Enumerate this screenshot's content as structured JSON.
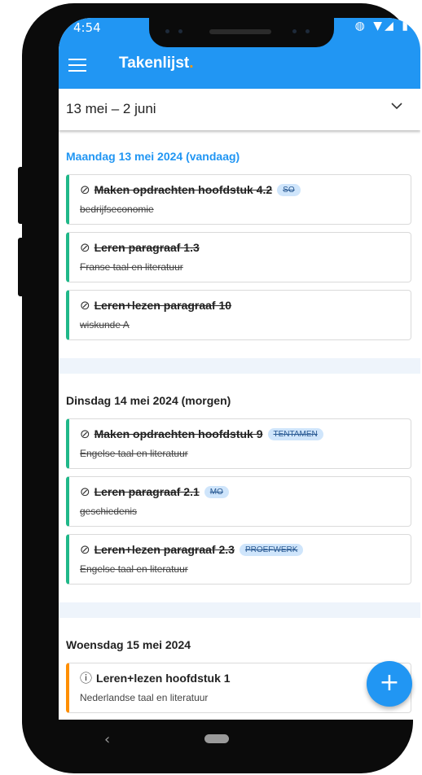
{
  "status": {
    "time": "4:54",
    "icons": "◍ ▼◢ ▮"
  },
  "appbar": {
    "title": "Takenlijst",
    "accent": "."
  },
  "range": {
    "label": "13 mei  –  2 juni"
  },
  "days": [
    {
      "header": "Maandag 13 mei 2024 (vandaag)",
      "tasks": [
        {
          "title": "Maken opdrachten hoofdstuk 4.2",
          "tag": "SO",
          "subject": "bedrijfseconomie",
          "status": "done"
        },
        {
          "title": "Leren paragraaf 1.3",
          "tag": "",
          "subject": "Franse taal en literatuur",
          "status": "done"
        },
        {
          "title": "Leren+lezen paragraaf 10",
          "tag": "",
          "subject": "wiskunde A",
          "status": "done"
        }
      ]
    },
    {
      "header": "Dinsdag 14 mei 2024 (morgen)",
      "tasks": [
        {
          "title": "Maken opdrachten hoofdstuk 9",
          "tag": "TENTAMEN",
          "subject": "Engelse taal en literatuur",
          "status": "done"
        },
        {
          "title": "Leren paragraaf 2.1",
          "tag": "MO",
          "subject": "geschiedenis",
          "status": "done"
        },
        {
          "title": "Leren+lezen paragraaf 2.3",
          "tag": "PROEFWERK",
          "subject": "Engelse taal en literatuur",
          "status": "done"
        }
      ]
    },
    {
      "header": "Woensdag 15 mei 2024",
      "tasks": [
        {
          "title": "Leren+lezen hoofdstuk 1",
          "tag": "",
          "subject": "Nederlandse taal en literatuur",
          "status": "pending"
        }
      ]
    }
  ],
  "icons": {
    "done": "check-circle-icon",
    "pending": "exclamation-circle-icon",
    "menu": "menu-icon",
    "fab": "add-icon"
  },
  "colors": {
    "primary": "#2196f3",
    "done_border": "#20b889",
    "pending_border": "#ff8f00",
    "tag_bg": "#cfe5fb"
  },
  "fab": {
    "label": "+"
  }
}
